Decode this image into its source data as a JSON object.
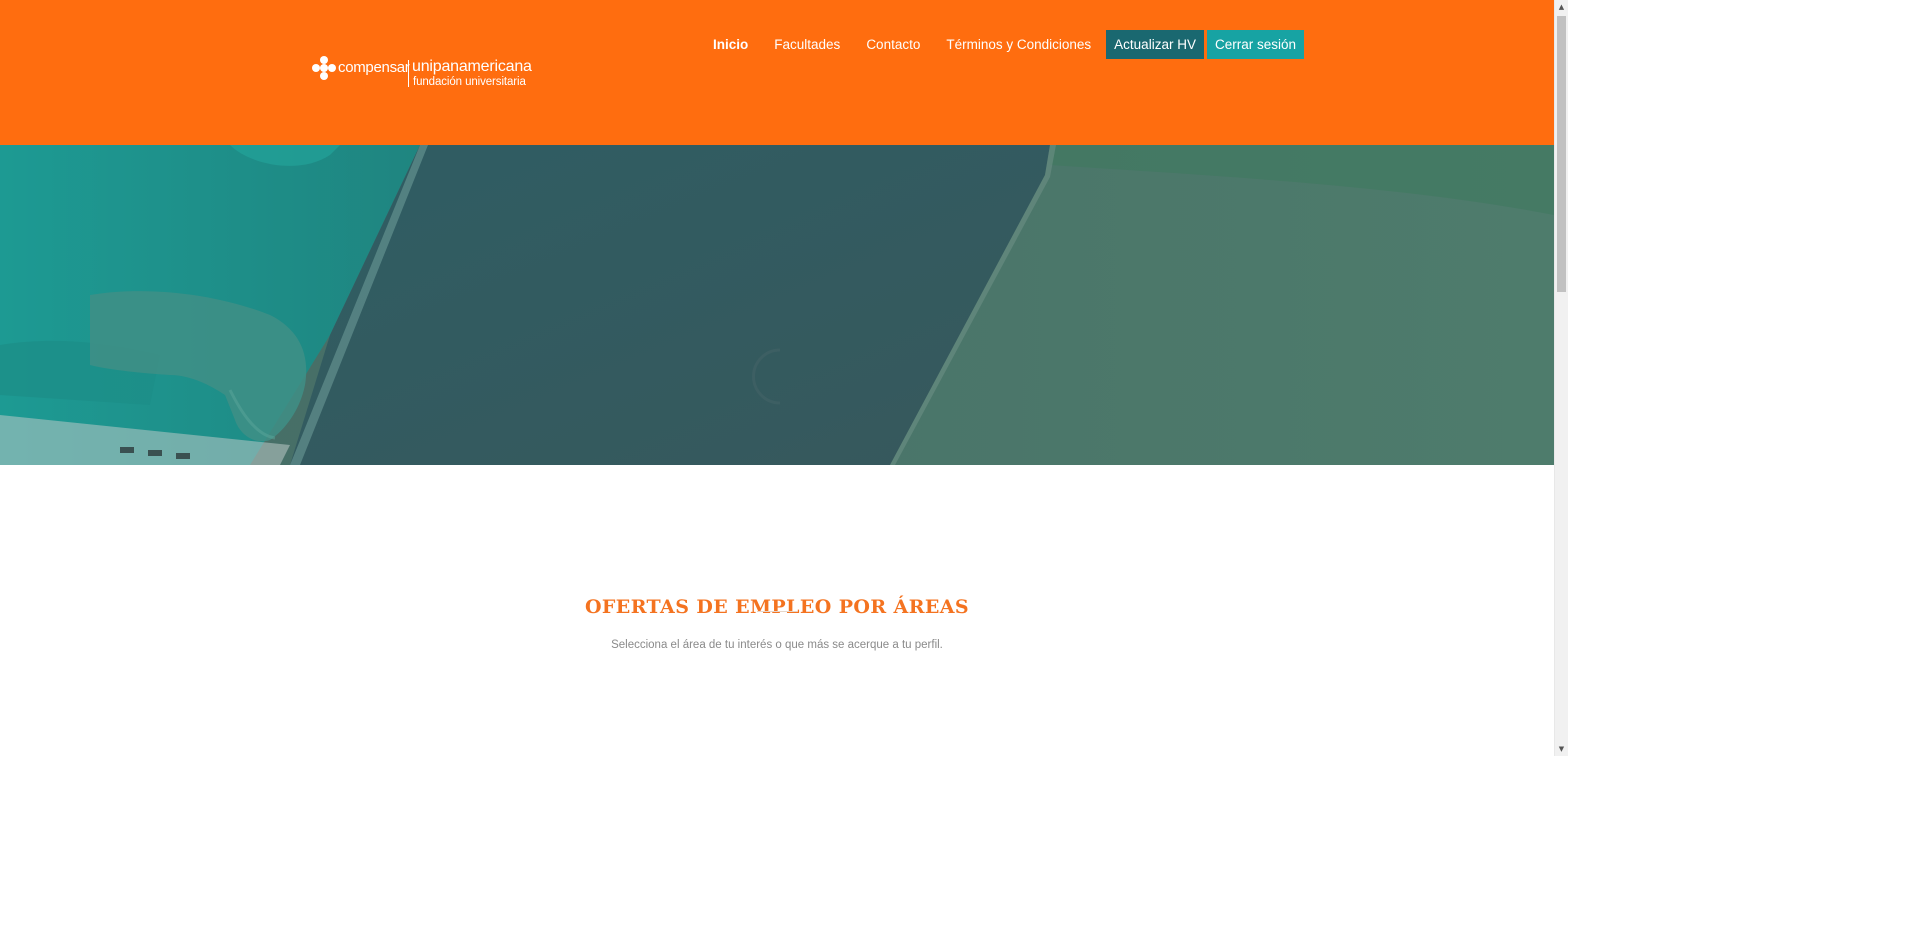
{
  "logo": {
    "brand": "compensar",
    "name": "unipanamericana",
    "tagline": "fundación universitaria"
  },
  "nav": {
    "items": [
      {
        "label": "Inicio",
        "active": true
      },
      {
        "label": "Facultades",
        "active": false
      },
      {
        "label": "Contacto",
        "active": false
      },
      {
        "label": "Términos y Condiciones",
        "active": false
      }
    ],
    "update_cv_label": "Actualizar HV",
    "logout_label": "Cerrar sesión"
  },
  "section": {
    "title": "OFERTAS DE EMPLEO POR ÁREAS",
    "subtitle": "Selecciona el área de tu interés o que más se acerque a tu perfil."
  },
  "colors": {
    "header_bg": "#ff6d0f",
    "update_cv_bg": "#1a6870",
    "logout_bg": "#17a3a3",
    "section_title": "#f47320",
    "hero_overlay": "#2b6f74"
  },
  "icons": {
    "scroll_up": "scroll-up-arrow-icon",
    "scroll_down": "scroll-down-arrow-icon",
    "loading": "loading-spinner-icon"
  }
}
